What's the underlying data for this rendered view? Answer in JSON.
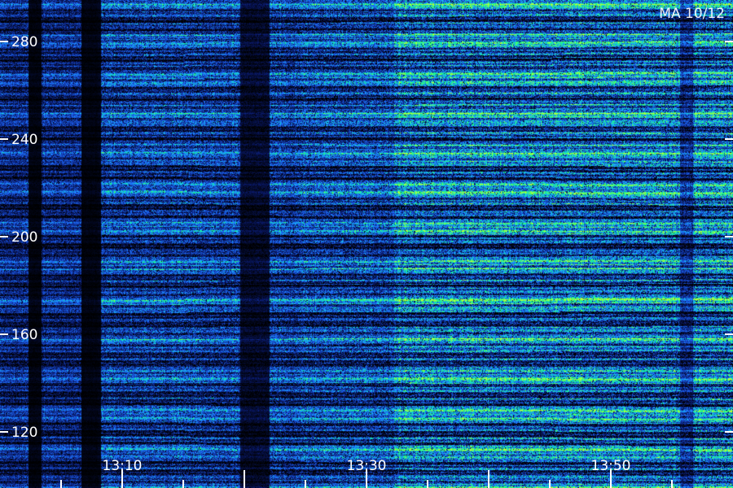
{
  "view": {
    "header_label": "MA 10/12"
  },
  "axes": {
    "y_ticks": [
      "280",
      "240",
      "200",
      "160",
      "120"
    ],
    "x_ticks": [
      "13:10",
      "13:30",
      "13:50"
    ]
  },
  "colors": {
    "background": "#000000",
    "low": "#0a1a6e",
    "mid": "#1e6bff",
    "high": "#19ff7a",
    "peak": "#b8ff3a",
    "text": "#ffffff"
  }
}
